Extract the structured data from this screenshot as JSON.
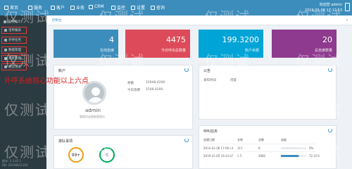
{
  "topbar": {
    "nav": [
      "首页",
      "服务",
      "客户",
      "业务",
      "CRM",
      "监控",
      "设置",
      "查询"
    ],
    "welcome": "欢迎您 admin",
    "datetime": "2019-05-08 17:12:53"
  },
  "sidebar": {
    "items": [
      "在线统计",
      "话单报表",
      "外呼任务",
      "数据管理",
      "系统管理",
      "通话记录"
    ],
    "footer": [
      "版本: 2.3.45.1",
      "DB: 20190611103"
    ]
  },
  "tabs": {
    "active": "控制台"
  },
  "stats": [
    {
      "value": "4",
      "label": "在线坐席",
      "color": "#3c8dbc"
    },
    {
      "value": "4475",
      "label": "今日呼出总数量",
      "color": "#dd4b5a"
    },
    {
      "value": "199.3200",
      "label": "账户余额",
      "color": "#00a4d6"
    },
    {
      "value": "20",
      "label": "总坐席数量",
      "color": "#8e3a8e"
    }
  ],
  "account": {
    "title": "账户",
    "username": "admin",
    "role": "管理员@超级管理员",
    "balance_label": "余额",
    "balance_value": "15648.4200",
    "today_label": "今日消费",
    "today_value": "1548.4200"
  },
  "notice": {
    "title": "公告",
    "col1": "发布时间",
    "col2": "内容"
  },
  "annotation": "外呼系统核心功能以上六点",
  "tasks": {
    "title": "呼叫任务",
    "headers": [
      "创建日期",
      "名称",
      "总数",
      "进度"
    ],
    "rows": [
      {
        "date": "2019-05-06 17:08:14",
        "name": "111",
        "total": "0",
        "percent_text": "0%",
        "percent": 0
      },
      {
        "date": "2019-05-05 16:24:37",
        "name": "5.5",
        "total": "3081",
        "percent_text": "72.25%",
        "percent": 72.25
      }
    ]
  },
  "queue": {
    "title": "排队事项",
    "badge1": "99+",
    "badge2": "0"
  },
  "watermark": "仅测试"
}
